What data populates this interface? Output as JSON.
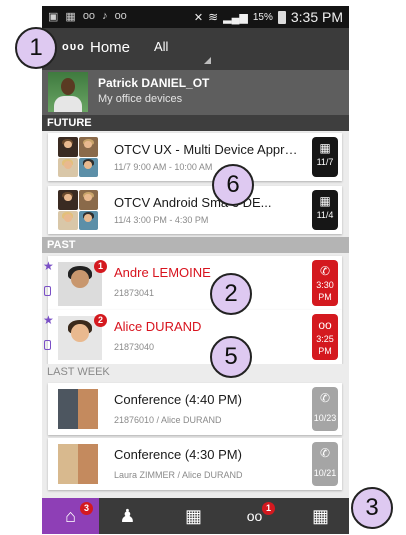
{
  "status_bar": {
    "left_icons": [
      "image-icon",
      "gallery-icon",
      "voicemail-icon",
      "app-icon",
      "alcatel-icon"
    ],
    "battery": "15%",
    "time": "3:35 PM"
  },
  "app_bar": {
    "logo": "ᴏᴜᴏ",
    "title": "Home",
    "filter": "All"
  },
  "profile": {
    "name": "Patrick DANIEL_OT",
    "subtitle": "My office devices"
  },
  "sections": {
    "future": "FUTURE",
    "past": "PAST",
    "last_week": "LAST WEEK"
  },
  "future_items": [
    {
      "title": "OTCV UX - Multi Device Approa...",
      "subtitle": "11/7 9:00 AM - 10:00 AM",
      "tag": "11/7"
    },
    {
      "title": "OTCV Android Sma     e DE...",
      "subtitle": "11/4 3:00 PM - 4:30 PM",
      "tag": "11/4"
    }
  ],
  "past_items": [
    {
      "title": "Andre LEMOINE",
      "subtitle": "21873041",
      "badge": "1",
      "tag_time": "3:30",
      "tag_ampm": "PM"
    },
    {
      "title": "Alice DURAND",
      "subtitle": "21873040",
      "badge": "2",
      "tag_time": "3:25",
      "tag_ampm": "PM"
    }
  ],
  "last_week_items": [
    {
      "title": "Conference (4:40 PM)",
      "subtitle": "21876010 / Alice DURAND",
      "tag": "10/23"
    },
    {
      "title": "Conference (4:30 PM)",
      "subtitle": "Laura ZIMMER / Alice DURAND",
      "tag": "10/21"
    }
  ],
  "bottom_tabs": [
    {
      "name": "home",
      "badge": "3"
    },
    {
      "name": "contacts",
      "badge": ""
    },
    {
      "name": "dialpad",
      "badge": ""
    },
    {
      "name": "voicemail",
      "badge": "1"
    },
    {
      "name": "calendar",
      "badge": ""
    }
  ],
  "callouts": [
    "1",
    "2",
    "3",
    "5",
    "6"
  ],
  "colors": {
    "accent_purple": "#8e3fb6",
    "missed_red": "#d4191f",
    "appbar": "#3b3b3b"
  }
}
